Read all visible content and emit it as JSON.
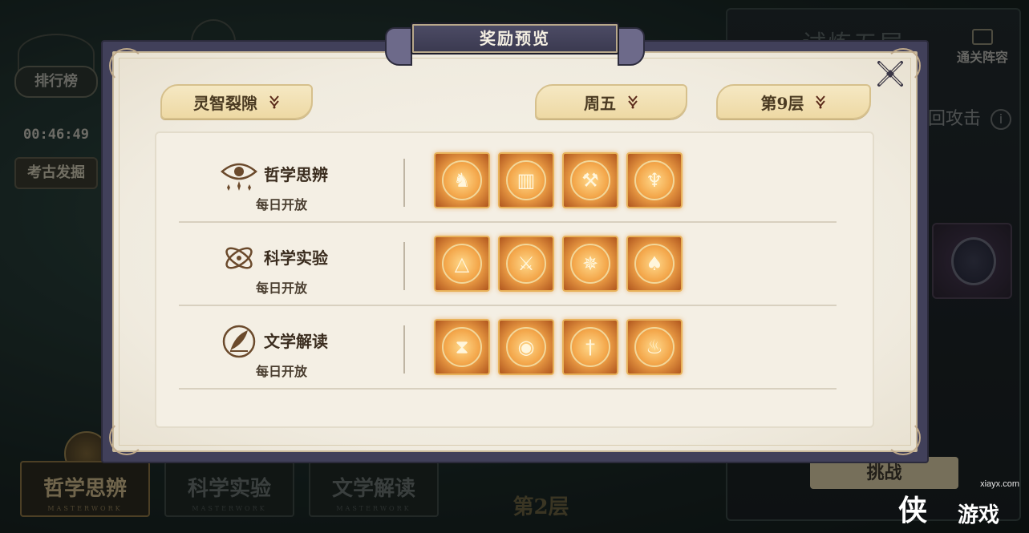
{
  "modal": {
    "title": "奖励预览",
    "dropdowns": {
      "region": "灵智裂隙",
      "day": "周五",
      "floor": "第9层"
    },
    "rows": [
      {
        "name": "哲学思辨",
        "availability": "每日开放",
        "icon": "eye-star-icon",
        "rewards": [
          {
            "icon": "beast-altar-icon",
            "glyph": "♞"
          },
          {
            "icon": "rune-tablet-icon",
            "glyph": "▥"
          },
          {
            "icon": "axe-icon",
            "glyph": "⚒"
          },
          {
            "icon": "chalice-icon",
            "glyph": "♆"
          }
        ]
      },
      {
        "name": "科学实验",
        "availability": "每日开放",
        "icon": "atom-orbit-icon",
        "rewards": [
          {
            "icon": "eye-pyramid-icon",
            "glyph": "△"
          },
          {
            "icon": "knife-icon",
            "glyph": "⚔"
          },
          {
            "icon": "spider-icon",
            "glyph": "✵"
          },
          {
            "icon": "spearhead-icon",
            "glyph": "♠"
          }
        ]
      },
      {
        "name": "文学解读",
        "availability": "每日开放",
        "icon": "quill-icon",
        "rewards": [
          {
            "icon": "hourglass-crescent-icon",
            "glyph": "⧗"
          },
          {
            "icon": "crystal-ball-icon",
            "glyph": "◉"
          },
          {
            "icon": "sword-icon",
            "glyph": "†"
          },
          {
            "icon": "oil-lamp-icon",
            "glyph": "♨"
          }
        ]
      }
    ]
  },
  "background": {
    "ranking": "排行榜",
    "timer": "00:46:49",
    "dig": "考古发掘",
    "right_title": "试炼五层",
    "clear_team": "通关阵容",
    "attack": "回攻击",
    "attack_info": "i",
    "challenge": "挑战",
    "floor": "第2层",
    "tabs": [
      {
        "label": "哲学思辨",
        "sub": "MASTERWORK"
      },
      {
        "label": "科学实验",
        "sub": "MASTERWORK"
      },
      {
        "label": "文学解读",
        "sub": "MASTERWORK"
      }
    ]
  },
  "watermark": {
    "url": "xiayx.com",
    "main": "侠",
    "sub": "游戏"
  },
  "colors": {
    "modal_frame": "#41405a",
    "paper": "#f4efe4",
    "gold_button": "#eed9a4",
    "reward_glow": "#f3a64a",
    "text_dark": "#3a2c1e"
  }
}
